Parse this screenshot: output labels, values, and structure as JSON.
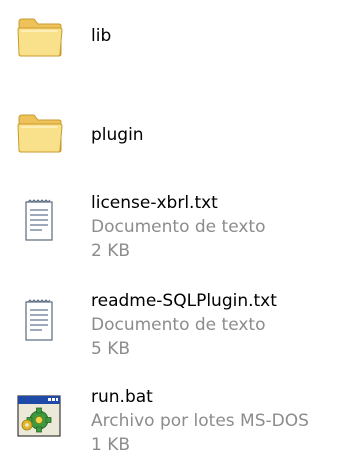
{
  "files": [
    {
      "name": "lib",
      "icon": "folder-icon"
    },
    {
      "name": "plugin",
      "icon": "folder-icon"
    },
    {
      "name": "license-xbrl.txt",
      "type": "Documento de texto",
      "size": "2 KB",
      "icon": "text-document-icon"
    },
    {
      "name": "readme-SQLPlugin.txt",
      "type": "Documento de texto",
      "size": "5 KB",
      "icon": "text-document-icon"
    },
    {
      "name": "run.bat",
      "type": "Archivo por lotes MS-DOS",
      "size": "1 KB",
      "icon": "batch-file-icon"
    }
  ],
  "colors": {
    "folder_front": "#f9e08a",
    "folder_back": "#eec25a",
    "folder_outline": "#c99a2e",
    "meta_text": "#8c8c8c"
  }
}
